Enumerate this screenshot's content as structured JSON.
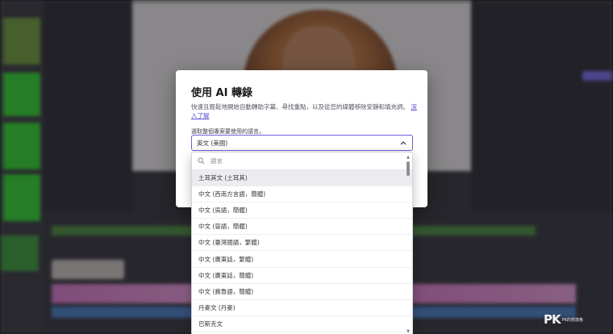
{
  "modal": {
    "title": "使用 AI 轉錄",
    "description": "快速且輕鬆地開始自動轉助字幕、尋找重點，以及從您的媒體移除安靜和填充詞。",
    "learn_more": "深入了解",
    "field_label": "選取整個專案要使用的語言。",
    "selected_language": "英文 (美國)"
  },
  "dropdown": {
    "search_placeholder": "語言",
    "options": [
      "土耳其文 (土耳其)",
      "中文 (西南方言語，簡體)",
      "中文 (吳語，簡體)",
      "中文 (晉語，簡體)",
      "中文 (臺灣國語，繁體)",
      "中文 (廣東話，繁體)",
      "中文 (廣東話，簡體)",
      "中文 (冀魯語，簡體)",
      "丹麥文 (丹麥)",
      "巴斯克文"
    ],
    "hovered_index": 0
  },
  "watermark": {
    "logo": "PK",
    "caption": "PK的部落格"
  },
  "colors": {
    "accent": "#6b5fd9",
    "link": "#5b4fd6"
  }
}
